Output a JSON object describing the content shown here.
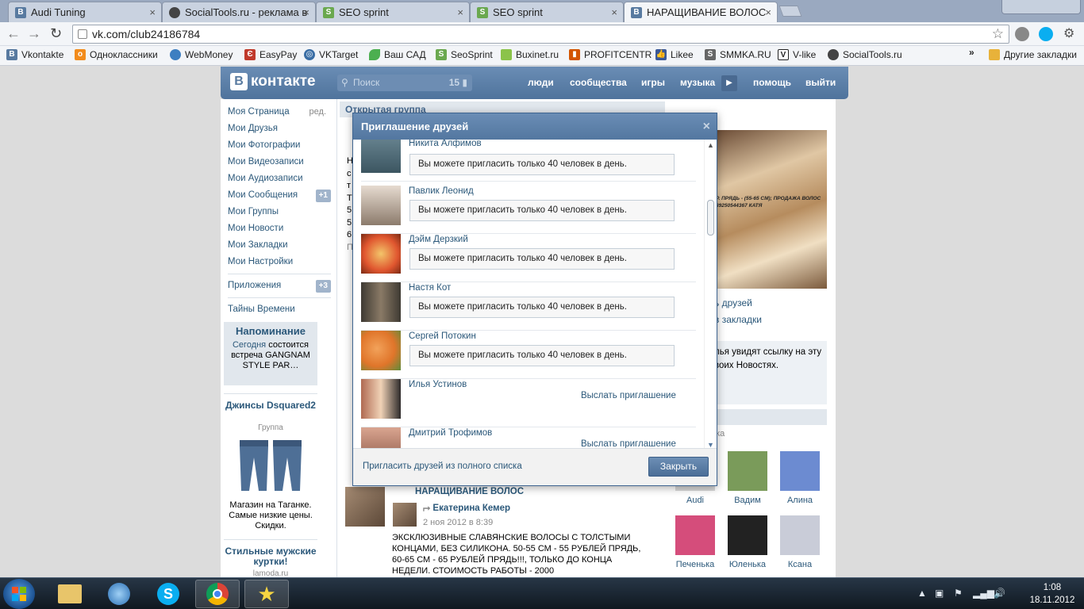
{
  "browser": {
    "tabs": [
      {
        "label": "Audi Tuning",
        "icon": "vk-icon",
        "color": "#587aa0"
      },
      {
        "label": "SocialTools.ru - реклама в",
        "icon": "socialtools-icon",
        "color": "#444444"
      },
      {
        "label": "SEO sprint",
        "icon": "seosprint-icon",
        "color": "#6aa84f"
      },
      {
        "label": "SEO sprint",
        "icon": "seosprint-icon",
        "color": "#6aa84f"
      },
      {
        "label": "НАРАЩИВАНИЕ ВОЛОС",
        "icon": "vk-icon",
        "color": "#587aa0"
      }
    ],
    "url": "vk.com/club24186784",
    "bookmarks": [
      {
        "label": "Vkontakte",
        "icon": "vk-icon",
        "color": "#587aa0"
      },
      {
        "label": "Одноклассники",
        "icon": "ok-icon",
        "color": "#f28c1c"
      },
      {
        "label": "WebMoney",
        "icon": "webmoney-icon",
        "color": "#3d7fc1"
      },
      {
        "label": "EasyPay",
        "icon": "easypay-icon",
        "color": "#c0392b"
      },
      {
        "label": "VKTarget",
        "icon": "vktarget-icon",
        "color": "#3a6ea5"
      },
      {
        "label": "Ваш САД",
        "icon": "leaf-icon",
        "color": "#4caf50"
      },
      {
        "label": "SeoSprint",
        "icon": "seosprint-icon",
        "color": "#6aa84f"
      },
      {
        "label": "Buxinet.ru",
        "icon": "buxinet-icon",
        "color": "#8bc34a"
      },
      {
        "label": "PROFITCENTR",
        "icon": "chart-icon",
        "color": "#d35400"
      },
      {
        "label": "Likee",
        "icon": "likee-icon",
        "color": "#3b5998"
      },
      {
        "label": "SMMKA.RU",
        "icon": "smmka-icon",
        "color": "#666666"
      },
      {
        "label": "V-like",
        "icon": "vlike-icon",
        "color": "#222222"
      },
      {
        "label": "SocialTools.ru",
        "icon": "socialtools-icon",
        "color": "#444444"
      }
    ],
    "more": "»",
    "other_bookmarks": "Другие закладки"
  },
  "vk": {
    "logo": "контакте",
    "logo_letter": "В",
    "search_placeholder": "Поиск",
    "search_count": "15",
    "nav": [
      "люди",
      "сообщества",
      "игры",
      "музыка",
      "помощь",
      "выйти"
    ],
    "menu": [
      {
        "label": "Моя Страница",
        "extra": "ред."
      },
      {
        "label": "Мои Друзья"
      },
      {
        "label": "Мои Фотографии"
      },
      {
        "label": "Мои Видеозаписи"
      },
      {
        "label": "Мои Аудиозаписи"
      },
      {
        "label": "Мои Сообщения",
        "badge": "+1"
      },
      {
        "label": "Мои Группы"
      },
      {
        "label": "Мои Новости"
      },
      {
        "label": "Мои Закладки"
      },
      {
        "label": "Мои Настройки"
      },
      {
        "label": "Приложения",
        "badge": "+3"
      },
      {
        "label": "Тайны Времени"
      }
    ],
    "reminder": {
      "title": "Напоминание",
      "today": "Сегодня",
      "text": " состоится встреча GANGNAM STYLE PAR…"
    },
    "ads": [
      {
        "title": "Джинсы Dsquared2",
        "sub": "Группа",
        "text": "Магазин на Таганке. Самые низкие цены. Скидки."
      },
      {
        "title": "Стильные мужские куртки!",
        "sub": "lamoda.ru"
      }
    ],
    "group_header": "Открытая группа",
    "right": {
      "photo_caption": "Р. ПРЯДЬ - (55-65 СМ); ПРОДАЖА ВОЛОС 89250544367 КАТЯ",
      "link1": "ь друзей",
      "link2": "в закладки",
      "text": "лья увидят ссылку на эту воих Новостях.",
      "bar": "и",
      "sub": "ека",
      "friends": [
        {
          "name": "Audi",
          "color": "#d8d8d8"
        },
        {
          "name": "Вадим",
          "color": "#7a9b5a"
        },
        {
          "name": "Алина",
          "color": "#6c8bd1"
        },
        {
          "name": "Печенька",
          "color": "#d54d7b"
        },
        {
          "name": "Юленька",
          "color": "#222222"
        },
        {
          "name": "Ксана",
          "color": "#c9ccd8"
        }
      ]
    },
    "post": {
      "group": "НАРАЩИВАНИЕ ВОЛОС",
      "author": "Екатерина Кемер",
      "date": "2 ноя 2012 в 8:39",
      "text": "ЭКСКЛЮЗИВНЫЕ СЛАВЯНСКИЕ ВОЛОСЫ С ТОЛСТЫМИ КОНЦАМИ, БЕЗ СИЛИКОНА. 50-55 СМ - 55 РУБЛЕЙ ПРЯДЬ, 60-65 СМ - 65 РУБЛЕЙ ПРЯДЬ!!!, ТОЛЬКО ДО КОНЦА НЕДЕЛИ. СТОИМОСТЬ РАБОТЫ - 2000"
    },
    "left_peek": [
      "Н",
      "с",
      "т",
      "Т",
      "5",
      "5",
      "6",
      "П"
    ]
  },
  "modal": {
    "title": "Приглашение друзей",
    "close_icon": "×",
    "rows": [
      {
        "name": "Никита Алфимов",
        "msg": "Вы можете пригласить только 40 человек в день.",
        "color": "#4b6b78"
      },
      {
        "name": "Павлик Леонид",
        "msg": "Вы можете пригласить только 40 человек в день.",
        "color": "#c7b8a8"
      },
      {
        "name": "Дэйм Дерзкий",
        "msg": "Вы можете пригласить только 40 человек в день.",
        "color": "#e0562f"
      },
      {
        "name": "Настя Кот",
        "msg": "Вы можете пригласить только 40 человек в день.",
        "color": "#5e5346"
      },
      {
        "name": "Сергей Потокин",
        "msg": "Вы можете пригласить только 40 человек в день.",
        "color": "#e98a2a"
      },
      {
        "name": "Илья Устинов",
        "invite": "Выслать приглашение",
        "color": "#8a7260"
      },
      {
        "name": "Дмитрий Трофимов",
        "invite": "Выслать приглашение",
        "color": "#b58070"
      }
    ],
    "footer_link": "Пригласить друзей из полного списка",
    "close_button": "Закрыть"
  },
  "taskbar": {
    "time": "1:08",
    "date": "18.11.2012"
  }
}
